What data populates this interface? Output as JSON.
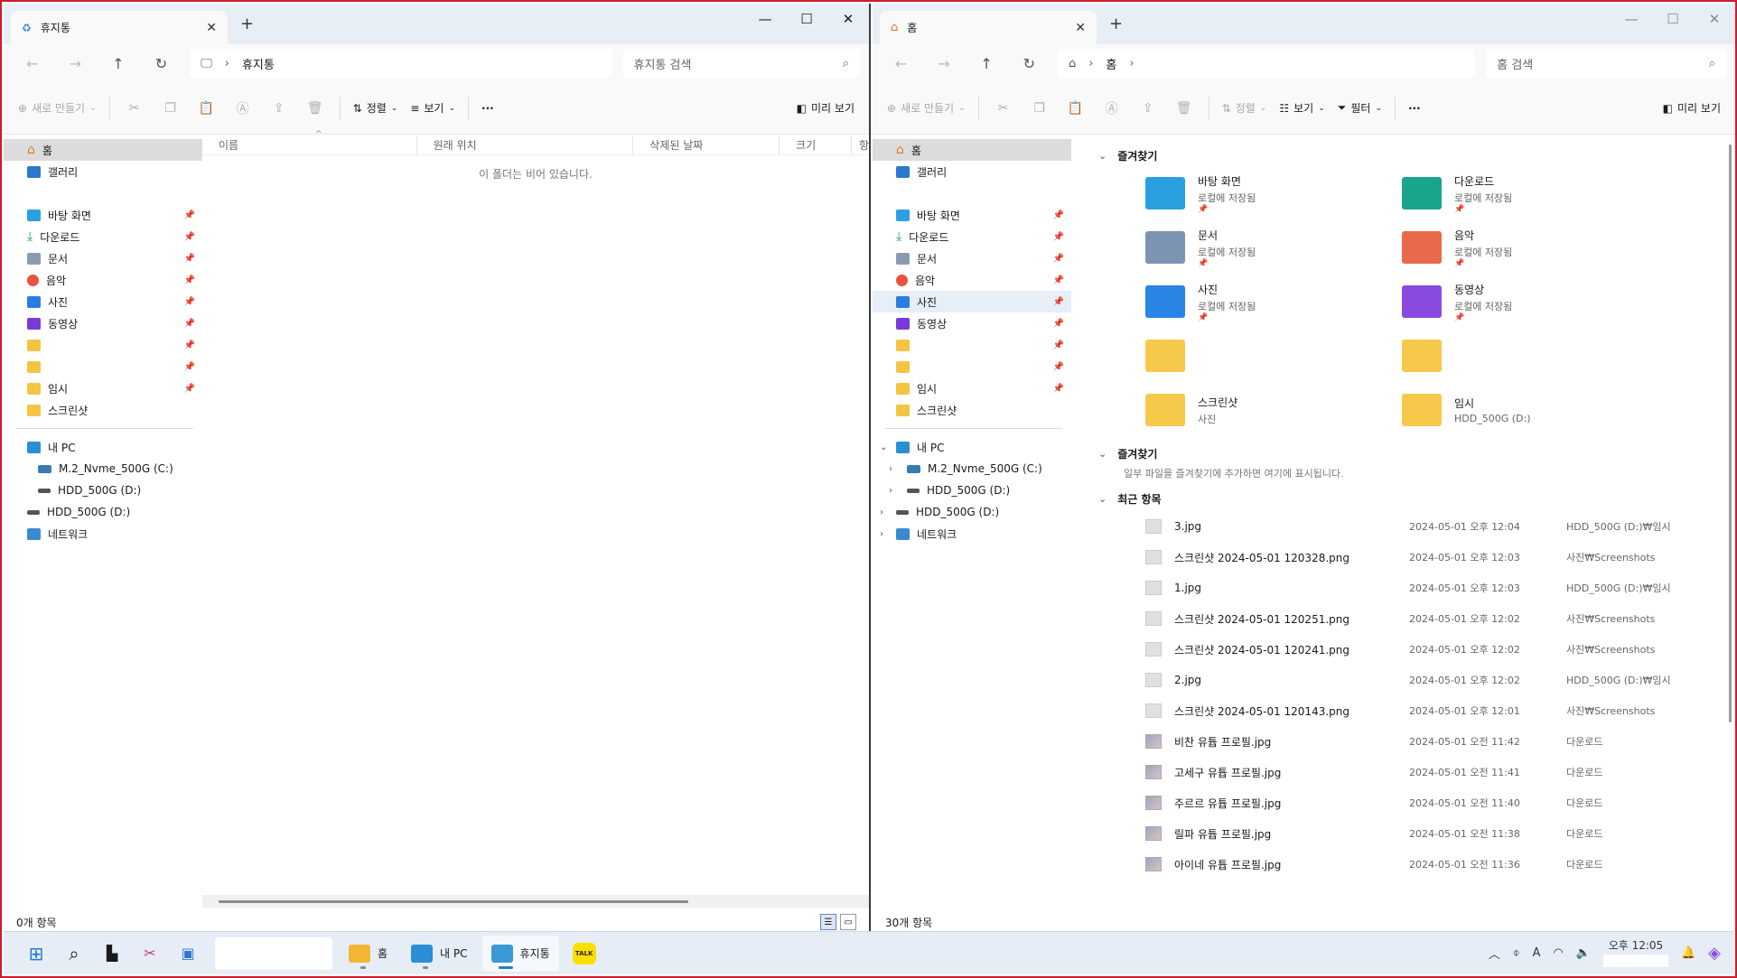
{
  "left": {
    "tab_title": "휴지통",
    "breadcrumb": "휴지통",
    "search_placeholder": "휴지통 검색",
    "toolbar": {
      "new": "새로 만들기",
      "sort": "정렬",
      "view": "보기",
      "preview": "미리 보기",
      "more": "···"
    },
    "columns": [
      "이름",
      "원래 위치",
      "삭제된 날짜",
      "크기",
      "항"
    ],
    "empty_message": "이 폴더는 비어 있습니다.",
    "status": "0개 항목"
  },
  "right": {
    "tab_title": "홈",
    "breadcrumb": "홈",
    "search_placeholder": "홈 검색",
    "toolbar": {
      "new": "새로 만들기",
      "sort": "정렬",
      "view": "보기",
      "filter": "필터",
      "preview": "미리 보기",
      "more": "···"
    },
    "quick_access_title": "즐겨찾기",
    "quick_access": [
      {
        "name": "바탕 화면",
        "sub": "로컬에 저장됨",
        "pinned": true,
        "color": "#2a9fe0"
      },
      {
        "name": "다운로드",
        "sub": "로컬에 저장됨",
        "pinned": true,
        "color": "#19a48c"
      },
      {
        "name": "문서",
        "sub": "로컬에 저장됨",
        "pinned": true,
        "color": "#7d93b2"
      },
      {
        "name": "음악",
        "sub": "로컬에 저장됨",
        "pinned": true,
        "color": "#e86a4a"
      },
      {
        "name": "사진",
        "sub": "로컬에 저장됨",
        "pinned": true,
        "color": "#2a84e4"
      },
      {
        "name": "동영상",
        "sub": "로컬에 저장됨",
        "pinned": true,
        "color": "#8a4ae0"
      },
      {
        "name": "",
        "sub": "",
        "pinned": false,
        "color": "#f6c94a"
      },
      {
        "name": "",
        "sub": "",
        "pinned": false,
        "color": "#f6c94a"
      },
      {
        "name": "스크린샷",
        "sub": "사진",
        "pinned": false,
        "color": "#f6c94a"
      },
      {
        "name": "임시",
        "sub": "HDD_500G (D:)",
        "pinned": false,
        "color": "#f6c94a"
      }
    ],
    "favorites_title": "즐겨찾기",
    "favorites_note": "일부 파일을 즐겨찾기에 추가하면 여기에 표시됩니다.",
    "recent_title": "최근 항목",
    "recent": [
      {
        "name": "3.jpg",
        "date": "2024-05-01 오후 12:04",
        "loc": "HDD_500G (D:)₩임시",
        "pic": false
      },
      {
        "name": "스크린샷 2024-05-01 120328.png",
        "date": "2024-05-01 오후 12:03",
        "loc": "사진₩Screenshots",
        "pic": false
      },
      {
        "name": "1.jpg",
        "date": "2024-05-01 오후 12:03",
        "loc": "HDD_500G (D:)₩임시",
        "pic": false
      },
      {
        "name": "스크린샷 2024-05-01 120251.png",
        "date": "2024-05-01 오후 12:02",
        "loc": "사진₩Screenshots",
        "pic": false
      },
      {
        "name": "스크린샷 2024-05-01 120241.png",
        "date": "2024-05-01 오후 12:02",
        "loc": "사진₩Screenshots",
        "pic": false
      },
      {
        "name": "2.jpg",
        "date": "2024-05-01 오후 12:02",
        "loc": "HDD_500G (D:)₩임시",
        "pic": false
      },
      {
        "name": "스크린샷 2024-05-01 120143.png",
        "date": "2024-05-01 오후 12:01",
        "loc": "사진₩Screenshots",
        "pic": false
      },
      {
        "name": "비찬 유튭 프로필.jpg",
        "date": "2024-05-01 오전 11:42",
        "loc": "다운로드",
        "pic": true
      },
      {
        "name": "고세구 유튭 프로필.jpg",
        "date": "2024-05-01 오전 11:41",
        "loc": "다운로드",
        "pic": true
      },
      {
        "name": "주르르 유튭 프로필.jpg",
        "date": "2024-05-01 오전 11:40",
        "loc": "다운로드",
        "pic": true
      },
      {
        "name": "릴파 유튭 프로필.jpg",
        "date": "2024-05-01 오전 11:38",
        "loc": "다운로드",
        "pic": true
      },
      {
        "name": "아이네 유튭 프로필.jpg",
        "date": "2024-05-01 오전 11:36",
        "loc": "다운로드",
        "pic": true
      }
    ],
    "status": "30개 항목"
  },
  "nav": {
    "home": "홈",
    "gallery": "갤러리",
    "desktop": "바탕 화면",
    "downloads": "다운로드",
    "documents": "문서",
    "music": "음악",
    "pictures": "사진",
    "videos": "동영상",
    "temp": "임시",
    "screenshots": "스크린샷",
    "this_pc": "내 PC",
    "drive_c": "M.2_Nvme_500G (C:)",
    "drive_d": "HDD_500G (D:)",
    "drive_d2": "HDD_500G (D:)",
    "network": "네트워크"
  },
  "taskbar": {
    "apps": [
      {
        "label": "홈",
        "color": "#f2b632"
      },
      {
        "label": "내 PC",
        "color": "#2a8fd6"
      },
      {
        "label": "휴지통",
        "color": "#3a9ad8"
      }
    ],
    "kakao": "TALK",
    "clock_time": "오후 12:05"
  }
}
